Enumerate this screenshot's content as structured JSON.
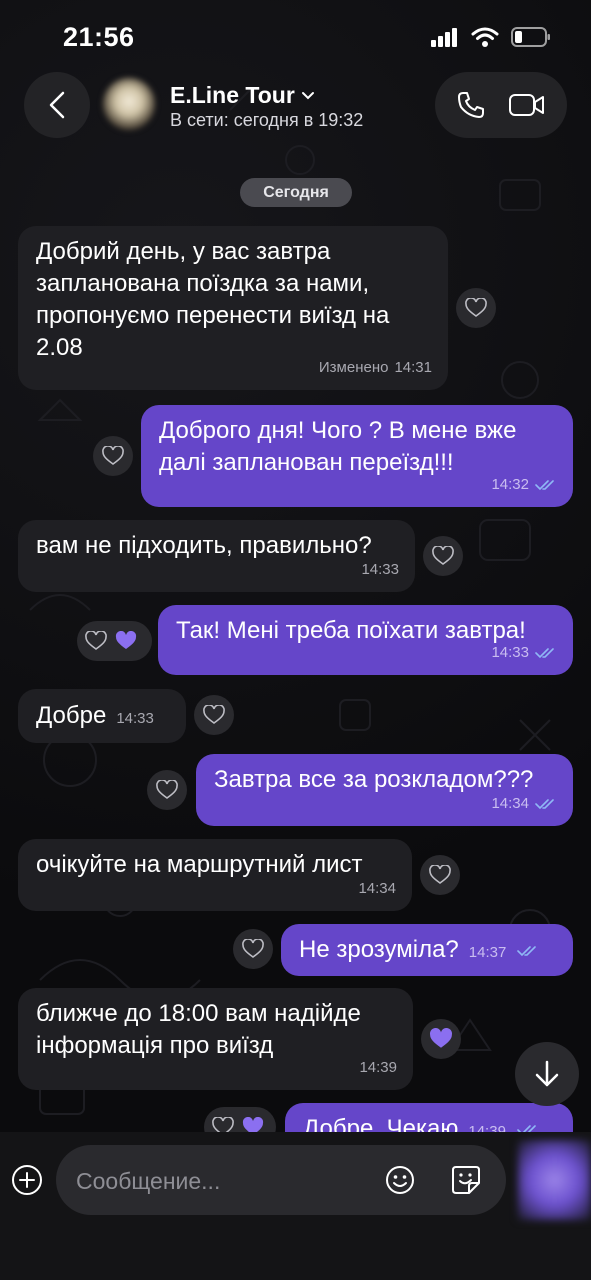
{
  "status_bar": {
    "time": "21:56"
  },
  "header": {
    "contact_name": "E.Line Tour",
    "contact_status": "В сети: сегодня в 19:32"
  },
  "date_chip": "Сегодня",
  "messages": [
    {
      "direction": "in",
      "lines": [
        "Добрий день, у вас завтра",
        "запланована поїздка за нами,",
        "пропонуємо перенести виїзд на",
        "2.08"
      ],
      "edited_label": "Изменено",
      "time": "14:31",
      "reactions": [
        "heart-outline"
      ]
    },
    {
      "direction": "out",
      "lines": [
        "Доброго дня! Чого ? В мене вже",
        "далі запланован переїзд!!!"
      ],
      "time": "14:32",
      "reactions": [
        "heart-outline"
      ]
    },
    {
      "direction": "in",
      "lines": [
        "вам не підходить, правильно?"
      ],
      "time": "14:33",
      "reactions": [
        "heart-outline"
      ]
    },
    {
      "direction": "out",
      "lines": [
        "Так! Мені треба поїхати завтра!"
      ],
      "time": "14:33",
      "reactions": [
        "heart-outline",
        "heart-filled"
      ]
    },
    {
      "direction": "in",
      "lines": [
        "Добре"
      ],
      "time": "14:33",
      "reactions": [
        "heart-outline"
      ]
    },
    {
      "direction": "out",
      "lines": [
        "Завтра все за розкладом???"
      ],
      "time": "14:34",
      "reactions": [
        "heart-outline"
      ]
    },
    {
      "direction": "in",
      "lines": [
        "очікуйте на маршрутний лист"
      ],
      "time": "14:34",
      "reactions": [
        "heart-outline"
      ]
    },
    {
      "direction": "out",
      "lines": [
        "Не зрозуміла?"
      ],
      "time": "14:37",
      "reactions": [
        "heart-outline"
      ]
    },
    {
      "direction": "in",
      "lines": [
        "ближче до 18:00 вам надійде",
        "інформація про виїзд"
      ],
      "time": "14:39",
      "reactions": [
        "heart-filled"
      ]
    },
    {
      "direction": "out",
      "lines": [
        "Добре. Чекаю"
      ],
      "time": "14:39",
      "reactions": [
        "heart-outline",
        "heart-filled"
      ]
    }
  ],
  "composer": {
    "placeholder": "Сообщение..."
  },
  "colors": {
    "outgoing_bubble": "#6546c9",
    "incoming_bubble": "#1f1f23",
    "read_checks": "#8fb8f5",
    "heart_filled": "#8b6ff0"
  }
}
